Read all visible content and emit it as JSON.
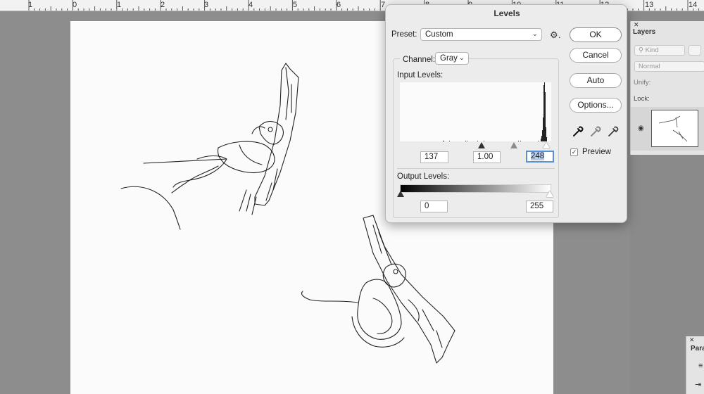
{
  "ruler": {
    "labels": [
      "1",
      "0",
      "1",
      "2",
      "3",
      "4",
      "5",
      "6",
      "7",
      "8",
      "9",
      "10",
      "11",
      "12",
      "13",
      "14"
    ]
  },
  "dialog": {
    "title": "Levels",
    "preset_label": "Preset:",
    "preset_value": "Custom",
    "channel_label": "Channel:",
    "channel_value": "Gray",
    "input_levels_label": "Input Levels:",
    "input_black": "137",
    "input_gamma": "1.00",
    "input_white": "248",
    "output_levels_label": "Output Levels:",
    "output_black": "0",
    "output_white": "255",
    "buttons": {
      "ok": "OK",
      "cancel": "Cancel",
      "auto": "Auto",
      "options": "Options..."
    },
    "preview_label": "Preview",
    "preview_checked": true
  },
  "layers_panel": {
    "title": "Layers",
    "kind_placeholder": "Kind",
    "blend_mode": "Normal",
    "unify_label": "Unify:",
    "lock_label": "Lock:"
  },
  "paragraph_panel": {
    "title": "Para"
  },
  "icons": [
    "gear-icon",
    "chevron-down-icon",
    "eyedropper-black-icon",
    "eyedropper-gray-icon",
    "eyedropper-white-icon",
    "eye-icon",
    "close-icon"
  ],
  "colors": {
    "focus": "#5b8fd6",
    "dialog_bg": "#ececec",
    "canvas_bg": "#8d8d8d"
  }
}
